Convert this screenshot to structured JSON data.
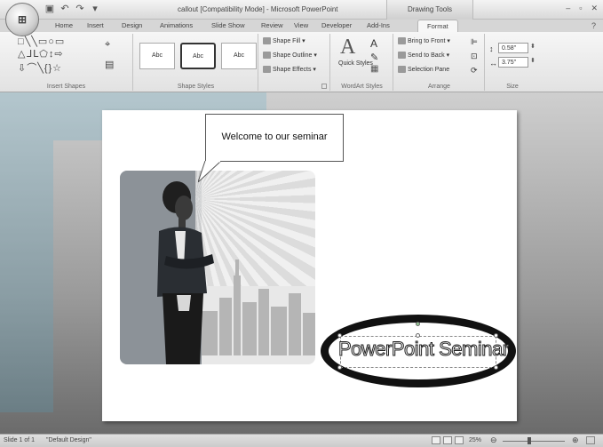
{
  "window": {
    "title": "callout [Compatibility Mode] - Microsoft PowerPoint",
    "contextual_tab_group": "Drawing Tools"
  },
  "office_button": {
    "label": ""
  },
  "tabs": [
    {
      "label": "Home"
    },
    {
      "label": "Insert"
    },
    {
      "label": "Design"
    },
    {
      "label": "Animations"
    },
    {
      "label": "Slide Show"
    },
    {
      "label": "Review"
    },
    {
      "label": "View"
    },
    {
      "label": "Developer"
    },
    {
      "label": "Add-Ins"
    },
    {
      "label": "Format",
      "active": true
    }
  ],
  "ribbon": {
    "insert_shapes": {
      "label": "Insert Shapes"
    },
    "shape_styles": {
      "label": "Shape Styles",
      "samples": [
        "Abc",
        "Abc",
        "Abc"
      ],
      "shape_fill": "Shape Fill",
      "shape_outline": "Shape Outline",
      "shape_effects": "Shape Effects"
    },
    "wordart_styles": {
      "label": "WordArt Styles",
      "quick_styles": "Quick Styles"
    },
    "arrange": {
      "label": "Arrange",
      "bring_to_front": "Bring to Front",
      "send_to_back": "Send to Back",
      "selection_pane": "Selection Pane"
    },
    "size": {
      "label": "Size",
      "height": "0.58\"",
      "width": "3.75\""
    }
  },
  "slide": {
    "callout_text": "Welcome to our seminar",
    "wordart_text": "PowerPoint Seminar"
  },
  "statusbar": {
    "slide_info": "Slide 1 of 1",
    "design": "\"Default Design\"",
    "zoom": "25%"
  },
  "icons": {
    "office_button": "office-logo-icon",
    "save": "save-icon",
    "undo": "undo-icon",
    "redo": "redo-icon",
    "help": "help-icon"
  }
}
